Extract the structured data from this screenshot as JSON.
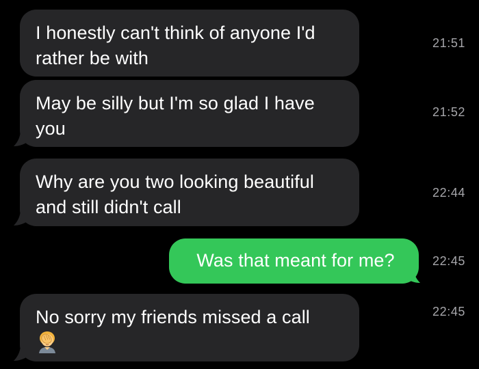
{
  "messages": [
    {
      "direction": "incoming",
      "text": "I honestly can't think of anyone I'd rather be with",
      "time": "21:51"
    },
    {
      "direction": "incoming",
      "text": "May be silly but I'm so glad I have you",
      "time": "21:52"
    },
    {
      "direction": "incoming",
      "text": "Why are you two looking beautiful and still didn't call",
      "time": "22:44"
    },
    {
      "direction": "outgoing",
      "text": "Was that meant for me?",
      "time": "22:45"
    },
    {
      "direction": "incoming",
      "text": "No sorry my friends missed a call",
      "time": "22:45",
      "emoji": "facepalm-emoji"
    }
  ],
  "colors": {
    "background": "#000000",
    "incoming_bubble": "#262628",
    "outgoing_bubble": "#34c759",
    "timestamp": "#a7a7ab",
    "text": "#ffffff"
  }
}
